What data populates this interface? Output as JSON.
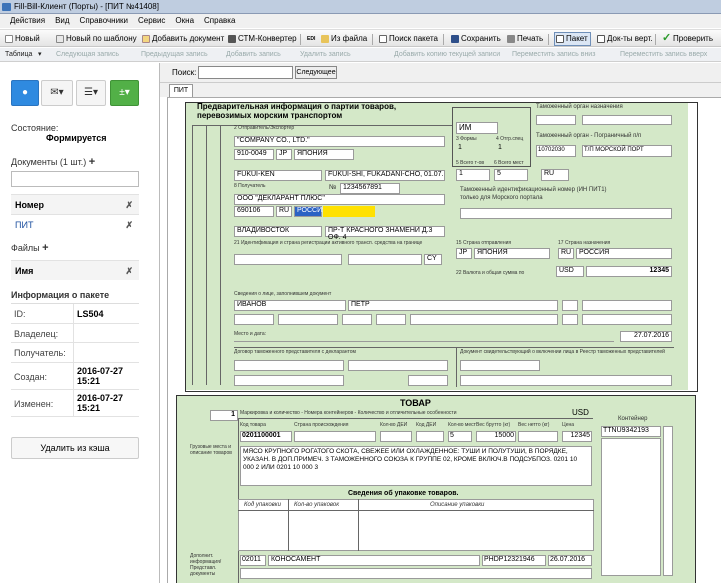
{
  "window": {
    "title": "Fill-Bill-Клиент (Порты) - [ПИТ №41408]"
  },
  "menu": [
    "Действия",
    "Вид",
    "Справочники",
    "Сервис",
    "Окна",
    "Справка"
  ],
  "toolbar": {
    "new": "Новый",
    "new_template": "Новый по шаблону",
    "add_doc": "Добавить документ",
    "ctm": "СТМ-Конвертер",
    "from_file": "Из файла",
    "search_pkg": "Поиск пакета",
    "save": "Сохранить",
    "print": "Печать",
    "package": "Пакет",
    "docs_vert": "Док-ты верт.",
    "check": "Проверить",
    "edi": "EDI"
  },
  "toolbar2": {
    "table": "Таблица",
    "next": "Следующая запись",
    "prev": "Предыдущая запись",
    "add": "Добавить запись",
    "delete": "Удалить запись",
    "copy": "Добавить копию текущей записи",
    "move_down": "Переместить запись вниз",
    "move_up": "Переместить запись вверх"
  },
  "left": {
    "state_label": "Состояние:",
    "state_value": "Формируется",
    "docs_header": "Документы (1 шт.)",
    "col_number": "Номер",
    "doc_name": "ПИТ",
    "files_header": "Файлы",
    "col_name": "Имя",
    "info_header": "Информация о пакете",
    "info": [
      {
        "k": "ID:",
        "v": "LS504"
      },
      {
        "k": "Владелец:",
        "v": ""
      },
      {
        "k": "Получатель:",
        "v": ""
      },
      {
        "k": "Создан:",
        "v": "2016-07-27 15:21"
      },
      {
        "k": "Изменен:",
        "v": "2016-07-27 15:21"
      }
    ],
    "cache_btn": "Удалить из кэша",
    "x": "✗",
    "plus": "+"
  },
  "search": {
    "label": "Поиск:",
    "button": "Следующее"
  },
  "tab": "ПИТ",
  "form": {
    "title1": "Предварительная информация о партии товаров,",
    "title2": "перевозимых морским транспортом",
    "im": "ИМ",
    "customs_dest": "Таможенный орган назначения",
    "customs_border": "Таможенный орган - Пограничный п/п",
    "border_code": "10702030",
    "border_name": "Т/П МОРСКОЙ ПОРТ",
    "sender_lbl": "2 Отправитель/Экспортер",
    "sender_name": "\"COMPANY CO., LTD.\"",
    "sender_code": "910-0049",
    "sender_cc": "JP",
    "sender_country": "ЯПОНИЯ",
    "sender_city": "FUKUI-KEN",
    "sender_addr": "FUKUI-SHI, FUKADANI-CHO, 01.07.",
    "num_lbl": "№",
    "num_val": "1234567891",
    "forms_lbl": "3 Формы",
    "spec_lbl": "4 Отгр.спец",
    "forms_val": "1",
    "spec_val": "1",
    "items_lbl": "5 Всего т-ов",
    "places_lbl": "6 Всего мест",
    "items_val": "1",
    "places_val": "5",
    "ru": "RU",
    "recv_lbl": "8 Получатель",
    "recv_name": "ООО \"ДЕКЛАРАНТ ПЛЮС\"",
    "recv_code": "690106",
    "recv_cc": "RU",
    "recv_country": "РОССИЯ",
    "recv_city": "ВЛАДИВОСТОК",
    "recv_addr": "ПР-Т КРАСНОГО ЗНАМЕНИ Д.3 ОФ. 4",
    "inn_lbl1": "Таможенный идентификационный номер (ИН ПИТ1)",
    "inn_lbl2": "только для Морского портала",
    "transport_lbl": "21 Идентификация и страна регистрации активного трансп. средства на границе",
    "cy": "CY",
    "dep_lbl": "15 Страна отправления",
    "dep_cc": "JP",
    "dep_country": "ЯПОНИЯ",
    "dest_lbl": "17 Страна назначения",
    "dest_cc": "RU",
    "dest_country": "РОССИЯ",
    "curr_lbl": "22 Валюта и общая сумма по",
    "currency": "USD",
    "total": "12345",
    "filler_lbl": "Сведения о лице, заполнившем документ",
    "last": "ИВАНОВ",
    "first": "ПЕТР",
    "place_lbl": "Место и дата:",
    "date": "27.07.2016",
    "contract_lbl": "Договор таможенного представителя с декларантом",
    "cert_lbl": "Документ свидетельствующий о включении лица в Реестр таможенных представителей",
    "goods_title": "ТОВАР",
    "goods_num": "1",
    "goods_marks_lbl": "Маркировка и количество - Номера контейнеров - Количество и отличительные особенности",
    "goods_cur": "USD",
    "cargo_lbl": "Грузовые места и описание товаров",
    "code_lbl": "Код товара",
    "origin_lbl": "Страна происхождения",
    "qty_lbl": "Кол-во ДЕИ",
    "dei_lbl": "Код ДЕИ",
    "places2_lbl": "Кол-во мест",
    "gross_lbl": "Вес брутто (кг)",
    "net_lbl": "Вес нетто (кг)",
    "price_lbl": "Цена",
    "code_val": "0201100001",
    "places2_val": "5",
    "gross_val": "15000",
    "price_val": "12345",
    "desc": "МЯСО КРУПНОГО РОГАТОГО СКОТА, СВЕЖЕЕ ИЛИ ОХЛАЖДЕННОЕ: ТУШИ И ПОЛУТУШИ, В ПОРЯДКЕ, УКАЗАН. В ДОП.ПРИМЕЧ. 3 ТАМОЖЕННОГО СОЮЗА К ГРУППЕ 02, КРОМЕ ВКЛЮЧ.В ПОДСУБПОЗ. 0201 10 000 2 ИЛИ 0201 10 000 3",
    "container_lbl": "Контейнер",
    "container": "TTNU9342193",
    "pack_title": "Сведения об упаковке товаров.",
    "pack_code": "Код упаковки",
    "pack_qty": "Кол-во упаковок",
    "pack_desc": "Описание упаковки",
    "extra_lbl": "Дополнит. информация/ Представл. документы",
    "doc_code": "02011",
    "doc_name": "КОНОСАМЕНТ",
    "doc_num": "PHDP12321946",
    "doc_date": "26.07.2016"
  }
}
